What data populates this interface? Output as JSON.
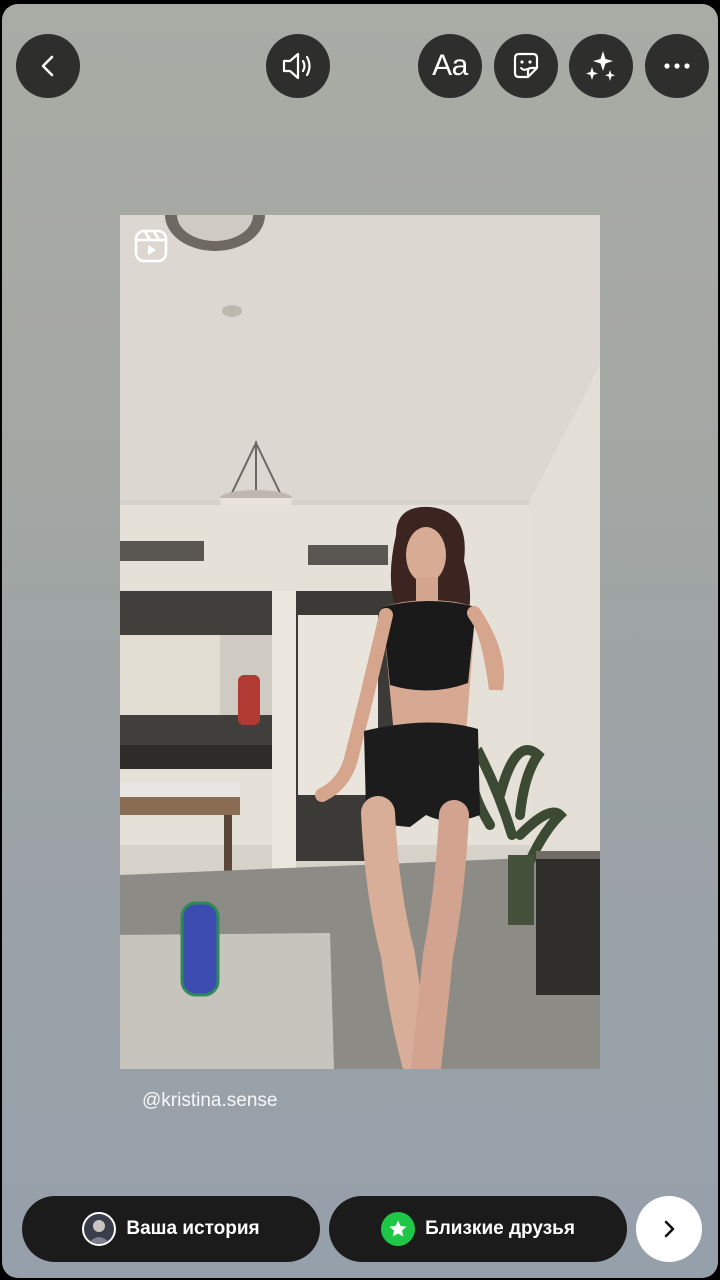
{
  "top_bar": {
    "back_icon": "chevron-left-icon",
    "sound_icon": "speaker-icon",
    "text_tool_label": "Aa",
    "sticker_icon": "sticker-icon",
    "effects_icon": "sparkles-icon",
    "more_icon": "more-horizontal-icon"
  },
  "media": {
    "reels_icon": "reels-icon",
    "mention": "@kristina.sense"
  },
  "bottom_bar": {
    "your_story_label": "Ваша история",
    "close_friends_label": "Близкие друзья",
    "close_friends_color": "#1ec745",
    "next_icon": "chevron-right-icon"
  }
}
